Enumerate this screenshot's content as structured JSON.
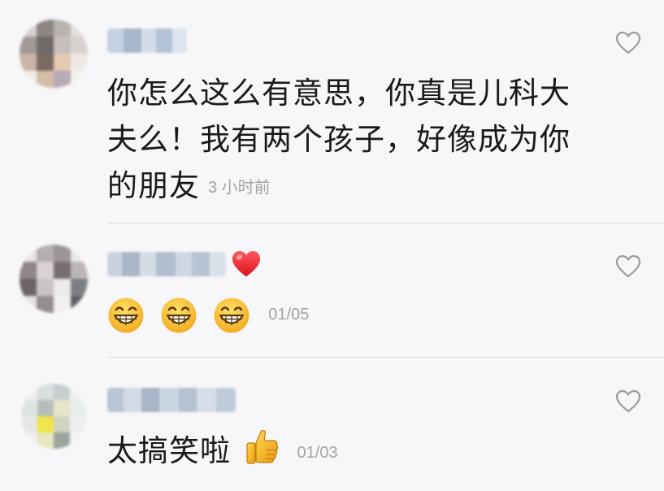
{
  "comments": [
    {
      "text": "你怎么这么有意思，你真是儿科大夫么！我有两个孩子，好像成为你的朋友",
      "line1": "你怎么这么有意思，你真是儿科大",
      "line2": "夫么！我有两个孩子，好像成为你",
      "line3": "的朋友",
      "time": "3 小时前",
      "like_icon": "heart-outline-icon"
    },
    {
      "name_emoji": "red-heart-emoji",
      "emoji": [
        "grinning-face-emoji",
        "grinning-face-emoji",
        "grinning-face-emoji"
      ],
      "time": "01/05",
      "like_icon": "heart-outline-icon"
    },
    {
      "text": "太搞笑啦",
      "emoji": "thumbs-up-emoji",
      "time": "01/03",
      "like_icon": "heart-outline-icon"
    }
  ],
  "colors": {
    "background": "#f7f7f9",
    "text": "#1a1a1a",
    "time": "#a3a3a8",
    "divider": "#dedee2",
    "heart_outline": "#9a9aa0",
    "heart_red": "#e5202e",
    "emoji_yellow": "#f7b82a",
    "thumb_yellow": "#f5b72c"
  }
}
